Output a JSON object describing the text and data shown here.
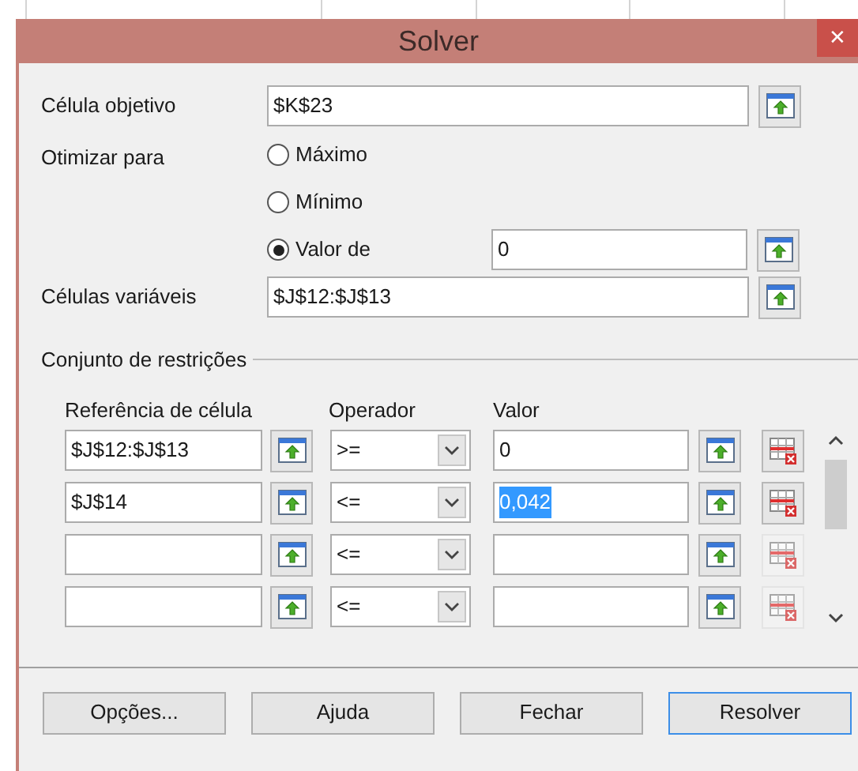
{
  "window": {
    "title": "Solver",
    "close": "✕"
  },
  "objective": {
    "label": "Célula objetivo",
    "value": "$K$23"
  },
  "optimize": {
    "label": "Otimizar para",
    "options": [
      {
        "label": "Máximo",
        "selected": false
      },
      {
        "label": "Mínimo",
        "selected": false
      },
      {
        "label": "Valor de",
        "selected": true,
        "value": "0"
      }
    ]
  },
  "variables": {
    "label": "Células variáveis",
    "value": "$J$12:$J$13"
  },
  "constraints": {
    "title": "Conjunto de restrições",
    "columns": [
      "Referência de célula",
      "Operador",
      "Valor"
    ],
    "rows": [
      {
        "reference": "$J$12:$J$13",
        "operator": ">=",
        "value": "0",
        "value_highlighted": false,
        "delete_disabled": false
      },
      {
        "reference": "$J$14",
        "operator": "<=",
        "value": "0,042",
        "value_highlighted": true,
        "delete_disabled": false
      },
      {
        "reference": "",
        "operator": "<=",
        "value": "",
        "value_highlighted": false,
        "delete_disabled": true
      },
      {
        "reference": "",
        "operator": "<=",
        "value": "",
        "value_highlighted": false,
        "delete_disabled": true
      }
    ]
  },
  "buttons": [
    {
      "label": "Opções...",
      "default": false
    },
    {
      "label": "Ajuda",
      "default": false
    },
    {
      "label": "Fechar",
      "default": false
    },
    {
      "label": "Resolver",
      "default": true
    }
  ]
}
